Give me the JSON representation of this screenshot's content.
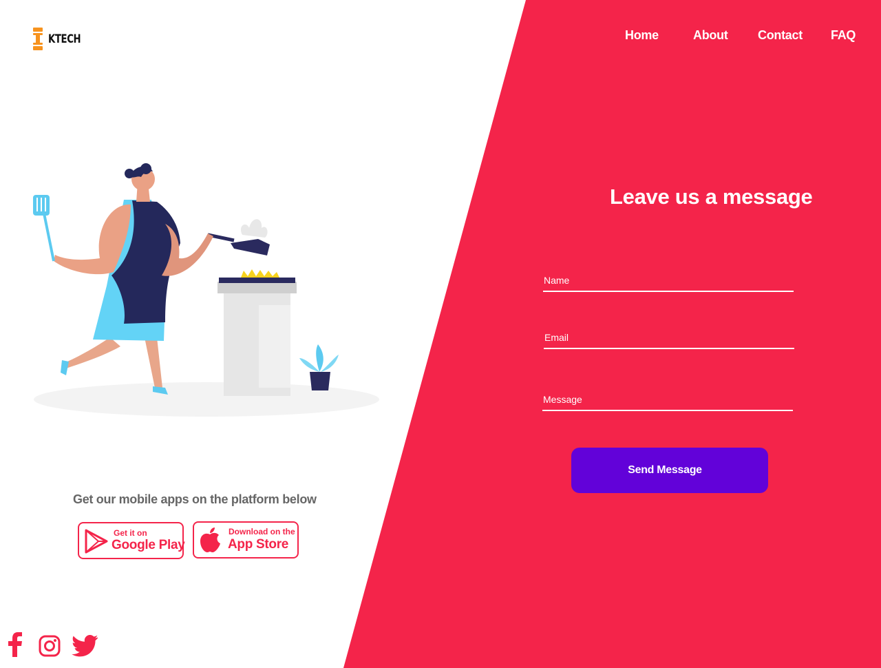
{
  "brand": {
    "name": "KTECH",
    "logo_color": "#f7931e"
  },
  "nav": {
    "items": [
      "Home",
      "About",
      "Contact",
      "FAQ"
    ]
  },
  "contact": {
    "heading": "Leave us a message",
    "name_placeholder": "Name",
    "email_placeholder": "Email",
    "message_placeholder": "Message",
    "send_label": "Send Message"
  },
  "apps": {
    "caption": "Get our mobile apps on the platform below",
    "google_play": {
      "small": "Get it on",
      "big": "Google Play",
      "icon": "play-icon"
    },
    "app_store": {
      "small": "Download on the",
      "big": "App Store",
      "icon": "apple-icon"
    }
  },
  "social": {
    "icons": [
      "facebook-icon",
      "instagram-icon",
      "twitter-icon"
    ]
  },
  "colors": {
    "accent": "#f4244a",
    "button": "#6202d9",
    "text_muted": "#666666"
  }
}
